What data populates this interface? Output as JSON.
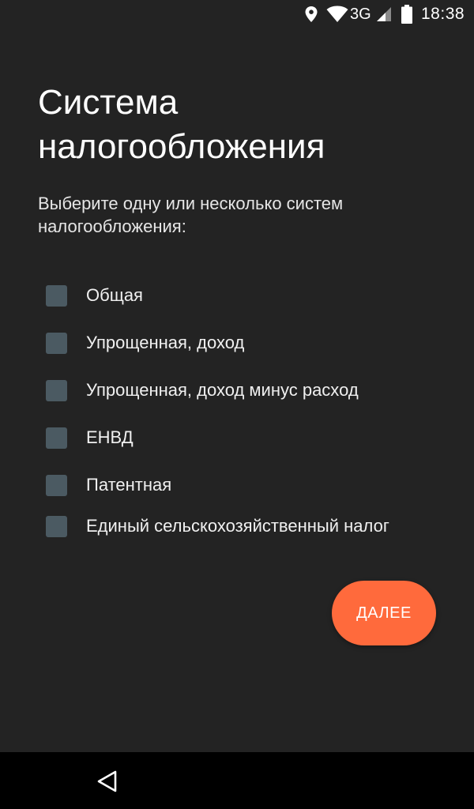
{
  "status_bar": {
    "network": "3G",
    "time": "18:38",
    "icons": [
      "location-icon",
      "wifi-icon",
      "cellular-signal-icon",
      "battery-icon"
    ]
  },
  "screen": {
    "title": "Система налогообложения",
    "subtitle": "Выберите одну или несколько систем налогообложения:",
    "options": [
      {
        "label": "Общая",
        "checked": false
      },
      {
        "label": "Упрощенная, доход",
        "checked": false
      },
      {
        "label": "Упрощенная, доход минус расход",
        "checked": false
      },
      {
        "label": "ЕНВД",
        "checked": false
      },
      {
        "label": "Патентная",
        "checked": false
      },
      {
        "label": "Единый сельскохозяйственный налог",
        "checked": false
      }
    ],
    "next_label": "ДАЛЕЕ"
  },
  "nav_bar": {
    "icons": [
      "back-icon"
    ]
  },
  "colors": {
    "background": "#232323",
    "accent": "#ff6a3c",
    "checkbox": "#4b5a62",
    "nav_bar": "#000000"
  }
}
